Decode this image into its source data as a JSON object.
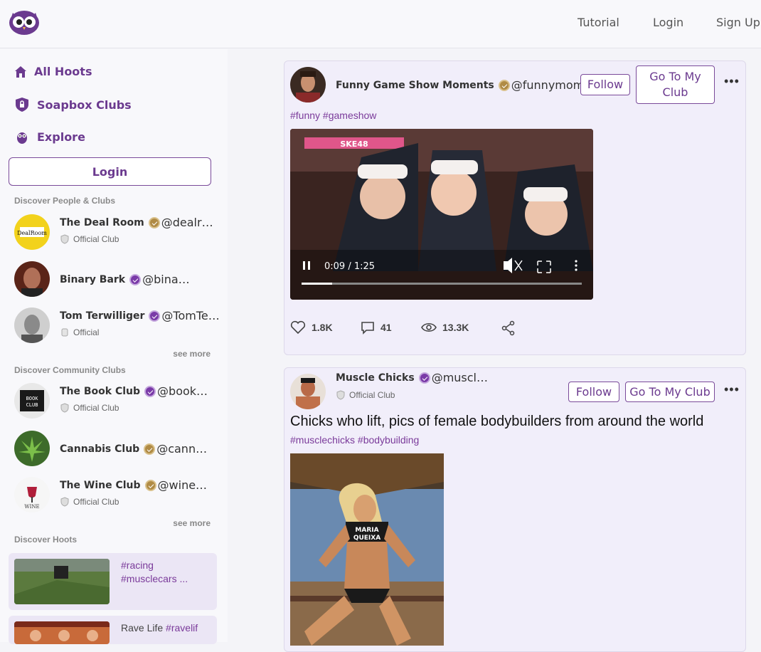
{
  "topnav": {
    "tutorial": "Tutorial",
    "login": "Login",
    "signup": "Sign Up"
  },
  "sidebar": {
    "nav": [
      {
        "label": "All Hoots",
        "icon": "home-icon"
      },
      {
        "label": "Soapbox Clubs",
        "icon": "shield-icon"
      },
      {
        "label": "Explore",
        "icon": "owl-icon"
      }
    ],
    "login_label": "Login",
    "discover_people_title": "Discover People & Clubs",
    "people": [
      {
        "name": "The Deal Room",
        "handle": "@dealr…",
        "badge": "gold",
        "sub": "Official Club"
      },
      {
        "name": "Binary Bark",
        "handle": "@bina…",
        "badge": "purple",
        "sub": ""
      },
      {
        "name": "Tom Terwilliger",
        "handle": "@TomTe…",
        "badge": "purple",
        "sub": "Official"
      }
    ],
    "see_more_1": "see more",
    "discover_clubs_title": "Discover Community Clubs",
    "clubs": [
      {
        "name": "The Book Club",
        "handle": "@book…",
        "badge": "purple",
        "sub": "Official Club"
      },
      {
        "name": "Cannabis Club",
        "handle": "@cann…",
        "badge": "gold",
        "sub": ""
      },
      {
        "name": "The Wine Club",
        "handle": "@wine…",
        "badge": "gold",
        "sub": "Official Club"
      }
    ],
    "see_more_2": "see more",
    "discover_hoots_title": "Discover Hoots",
    "hoots": [
      {
        "tags": "#racing #musclecars ...",
        "plain": ""
      },
      {
        "plain": "Rave Life ",
        "tags": "#ravelif"
      }
    ]
  },
  "posts": [
    {
      "name": "Funny Game Show Moments",
      "handle": "@funnymom…",
      "badge": "gold",
      "follow_label": "Follow",
      "club_label": "Go To My Club",
      "hashtags": "#funny #gameshow",
      "video_time": "0:09 / 1:25",
      "video_progress": 0.11,
      "likes": "1.8K",
      "comments": "41",
      "views": "13.3K"
    },
    {
      "name": "Muscle Chicks",
      "handle": "@muscl…",
      "badge": "purple",
      "sub": "Official Club",
      "follow_label": "Follow",
      "club_label": "Go To My Club",
      "text": "Chicks who lift, pics of female bodybuilders from around the world",
      "hashtags": "#musclechicks #bodybuilding"
    }
  ],
  "colors": {
    "accent": "#6b3a8f",
    "card_bg": "#f1eefa",
    "gold_badge": "#b08b45",
    "purple_badge": "#7a3aa8"
  }
}
